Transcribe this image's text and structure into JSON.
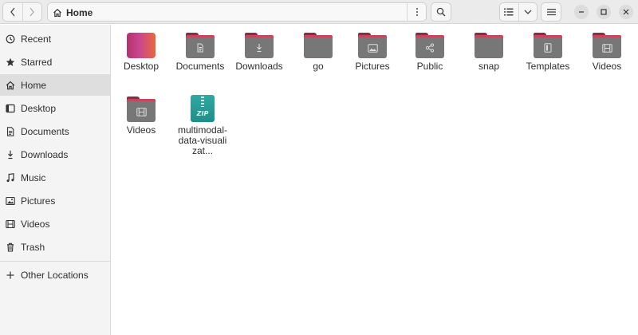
{
  "header": {
    "location_title": "Home",
    "icons": {
      "back": "chevron-left-icon",
      "forward": "chevron-right-icon",
      "home": "home-icon",
      "path_menu": "kebab-menu-icon",
      "search": "search-icon",
      "view_list": "list-view-icon",
      "view_options": "chevron-down-icon",
      "main_menu": "hamburger-menu-icon",
      "minimize": "minimize-icon",
      "maximize": "maximize-icon",
      "close": "close-icon"
    },
    "forward_enabled": false
  },
  "sidebar": {
    "items": [
      {
        "label": "Recent",
        "icon": "clock-icon",
        "active": false
      },
      {
        "label": "Starred",
        "icon": "star-icon",
        "active": false
      },
      {
        "label": "Home",
        "icon": "home-icon",
        "active": true
      },
      {
        "label": "Desktop",
        "icon": "desktop-icon",
        "active": false
      },
      {
        "label": "Documents",
        "icon": "document-icon",
        "active": false
      },
      {
        "label": "Downloads",
        "icon": "download-icon",
        "active": false
      },
      {
        "label": "Music",
        "icon": "music-note-icon",
        "active": false
      },
      {
        "label": "Pictures",
        "icon": "picture-icon",
        "active": false
      },
      {
        "label": "Videos",
        "icon": "film-icon",
        "active": false
      },
      {
        "label": "Trash",
        "icon": "trash-icon",
        "active": false
      }
    ],
    "other_locations": {
      "label": "Other Locations",
      "icon": "plus-icon"
    }
  },
  "files": [
    {
      "name": "Desktop",
      "kind": "desktop-folder",
      "icon": "desktop-folder-icon"
    },
    {
      "name": "Documents",
      "kind": "folder",
      "icon": "document-folder-icon"
    },
    {
      "name": "Downloads",
      "kind": "folder",
      "icon": "download-folder-icon"
    },
    {
      "name": "go",
      "kind": "folder",
      "icon": "folder-icon"
    },
    {
      "name": "Pictures",
      "kind": "folder",
      "icon": "picture-folder-icon"
    },
    {
      "name": "Public",
      "kind": "folder",
      "icon": "share-folder-icon"
    },
    {
      "name": "snap",
      "kind": "folder",
      "icon": "folder-icon"
    },
    {
      "name": "Templates",
      "kind": "folder",
      "icon": "template-folder-icon"
    },
    {
      "name": "Videos",
      "kind": "folder",
      "icon": "video-folder-icon"
    },
    {
      "name": "Videos",
      "kind": "folder",
      "icon": "video-folder-icon"
    },
    {
      "name": "multimodal-data-visualizat...",
      "kind": "zip",
      "icon": "zip-archive-icon",
      "badge": "ZIP"
    }
  ],
  "colors": {
    "folder_tab": "#8d2b47",
    "folder_back": "#c4485a",
    "folder_front": "#777777",
    "zip": "#2fa9a0",
    "sidebar_bg": "#f4f4f4",
    "sidebar_active": "#dedede",
    "header_bg": "#ebebeb"
  }
}
